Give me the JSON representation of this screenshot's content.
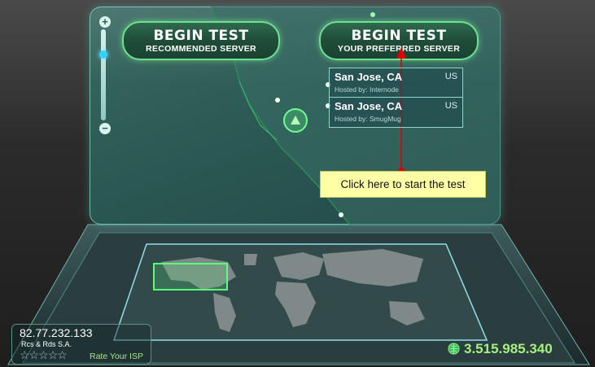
{
  "zoom": {
    "plus_label": "+",
    "minus_label": "−",
    "level": 0.25
  },
  "buttons": {
    "recommended": {
      "title": "BEGIN TEST",
      "subtitle": "RECOMMENDED SERVER"
    },
    "preferred": {
      "title": "BEGIN TEST",
      "subtitle": "YOUR PREFERRED SERVER"
    }
  },
  "servers": [
    {
      "city": "San Jose, CA",
      "host": "Hosted by: Internode",
      "country": "US"
    },
    {
      "city": "San Jose, CA",
      "host": "Hosted by: SmugMug",
      "country": "US"
    }
  ],
  "tooltip": "Click here to start the test",
  "client": {
    "ip": "82.77.232.133",
    "isp": "Rcs & Rds S.A.",
    "rating_stars": 0,
    "rate_label": "Rate Your ISP"
  },
  "tests_counter": "3.515.985.340",
  "colors": {
    "accent_green": "#6fe08f",
    "panel_teal": "#2c5a55",
    "arrow_red": "#e00000",
    "tooltip_yellow": "#ffffa5",
    "counter_green": "#a6f07f"
  },
  "icons": {
    "globe": "globe-icon",
    "star": "star-icon",
    "server_marker": "triangle-marker-icon"
  }
}
